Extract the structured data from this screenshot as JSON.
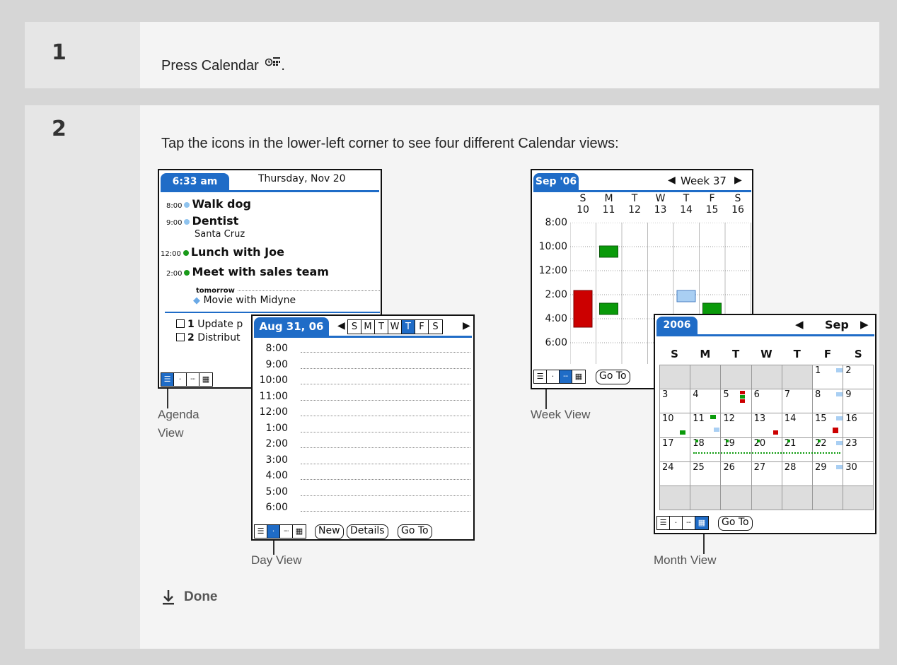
{
  "steps": [
    {
      "number": "1",
      "text": "Press Calendar",
      "icon": "calendar-button-icon",
      "suffix": "."
    },
    {
      "number": "2",
      "text": "Tap the icons in the lower-left corner to see four different Calendar views:"
    }
  ],
  "agenda": {
    "time": "6:33 am",
    "date": "Thursday, Nov 20",
    "events": [
      {
        "time": "8:00",
        "title": "Walk dog",
        "dot": "#8fc3ee"
      },
      {
        "time": "9:00",
        "title": "Dentist",
        "dot": "#8fc3ee",
        "sub": "Santa Cruz"
      },
      {
        "time": "12:00",
        "title": "Lunch with Joe",
        "dot": "#1a9a1a"
      },
      {
        "time": "2:00",
        "title": "Meet with sales team",
        "dot": "#1a9a1a"
      }
    ],
    "tomorrow_label": "tomorrow",
    "tomorrow_event": "Movie with Midyne",
    "tasks": [
      {
        "priority": "1",
        "text": "Update p"
      },
      {
        "priority": "2",
        "text": "Distribut"
      }
    ],
    "caption_line1": "Agenda",
    "caption_line2": "View"
  },
  "day": {
    "date": "Aug 31, 06",
    "weekdays": [
      "S",
      "M",
      "T",
      "W",
      "T",
      "F",
      "S"
    ],
    "selected_day_index": 4,
    "times": [
      "8:00",
      "9:00",
      "10:00",
      "11:00",
      "12:00",
      "1:00",
      "2:00",
      "3:00",
      "4:00",
      "5:00",
      "6:00"
    ],
    "buttons": [
      "New",
      "Details",
      "Go To"
    ],
    "caption": "Day View"
  },
  "week": {
    "month": "Sep '06",
    "week_label": "Week 37",
    "days": [
      {
        "letter": "S",
        "num": "10"
      },
      {
        "letter": "M",
        "num": "11"
      },
      {
        "letter": "T",
        "num": "12"
      },
      {
        "letter": "W",
        "num": "13"
      },
      {
        "letter": "T",
        "num": "14"
      },
      {
        "letter": "F",
        "num": "15"
      },
      {
        "letter": "S",
        "num": "16"
      }
    ],
    "times": [
      "8:00",
      "10:00",
      "12:00",
      "2:00",
      "4:00",
      "6:00"
    ],
    "button": "Go To",
    "caption": "Week View"
  },
  "month": {
    "year": "2006",
    "month": "Sep",
    "weekday_letters": [
      "S",
      "M",
      "T",
      "W",
      "T",
      "F",
      "S"
    ],
    "weeks": [
      [
        "",
        "",
        "",
        "",
        "",
        "1",
        "2"
      ],
      [
        "3",
        "4",
        "5",
        "6",
        "7",
        "8",
        "9"
      ],
      [
        "10",
        "11",
        "12",
        "13",
        "14",
        "15",
        "16"
      ],
      [
        "17",
        "18",
        "19",
        "20",
        "21",
        "22",
        "23"
      ],
      [
        "24",
        "25",
        "26",
        "27",
        "28",
        "29",
        "30"
      ],
      [
        "",
        "",
        "",
        "",
        "",
        "",
        ""
      ]
    ],
    "button": "Go To",
    "caption": "Month View"
  },
  "done_label": "Done",
  "colors": {
    "accent": "#1f6cc7",
    "event_red": "#cc0000",
    "event_green": "#0a9a0a",
    "event_blue": "#a9cff3"
  }
}
